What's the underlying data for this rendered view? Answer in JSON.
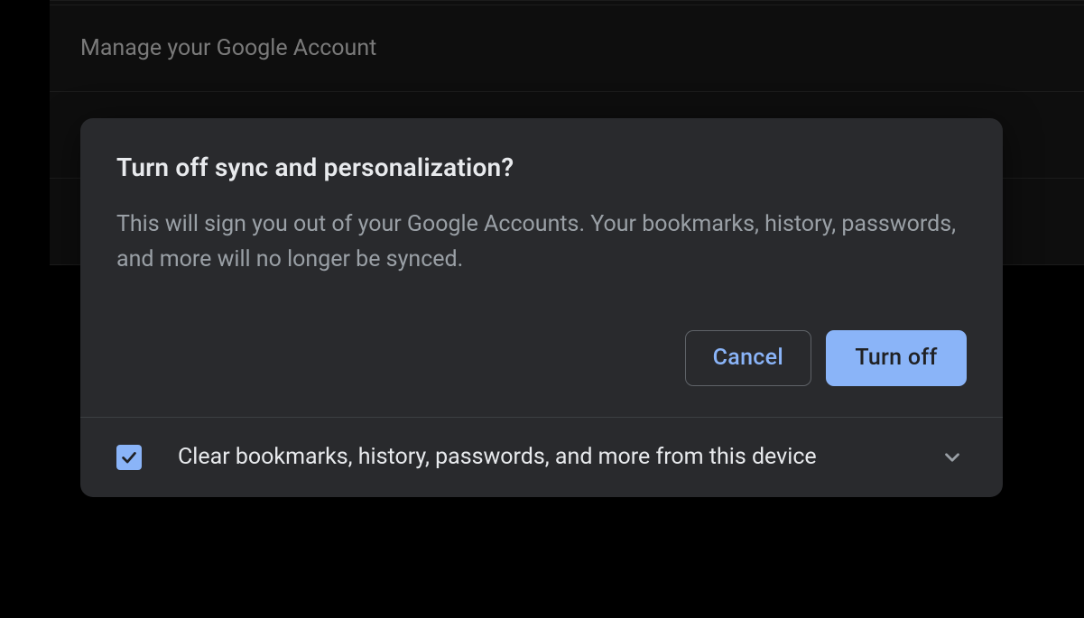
{
  "background": {
    "manage_account_label": "Manage your Google Account"
  },
  "dialog": {
    "title": "Turn off sync and personalization?",
    "description": "This will sign you out of your Google Accounts. Your bookmarks, history, passwords, and more will no longer be synced.",
    "cancel_label": "Cancel",
    "confirm_label": "Turn off",
    "clear_data_label": "Clear bookmarks, history, passwords, and more from this device",
    "clear_data_checked": true
  },
  "colors": {
    "accent": "#8ab4f8",
    "surface": "#292a2d",
    "on_surface": "#e8eaed",
    "on_surface_variant": "#9aa0a6"
  }
}
